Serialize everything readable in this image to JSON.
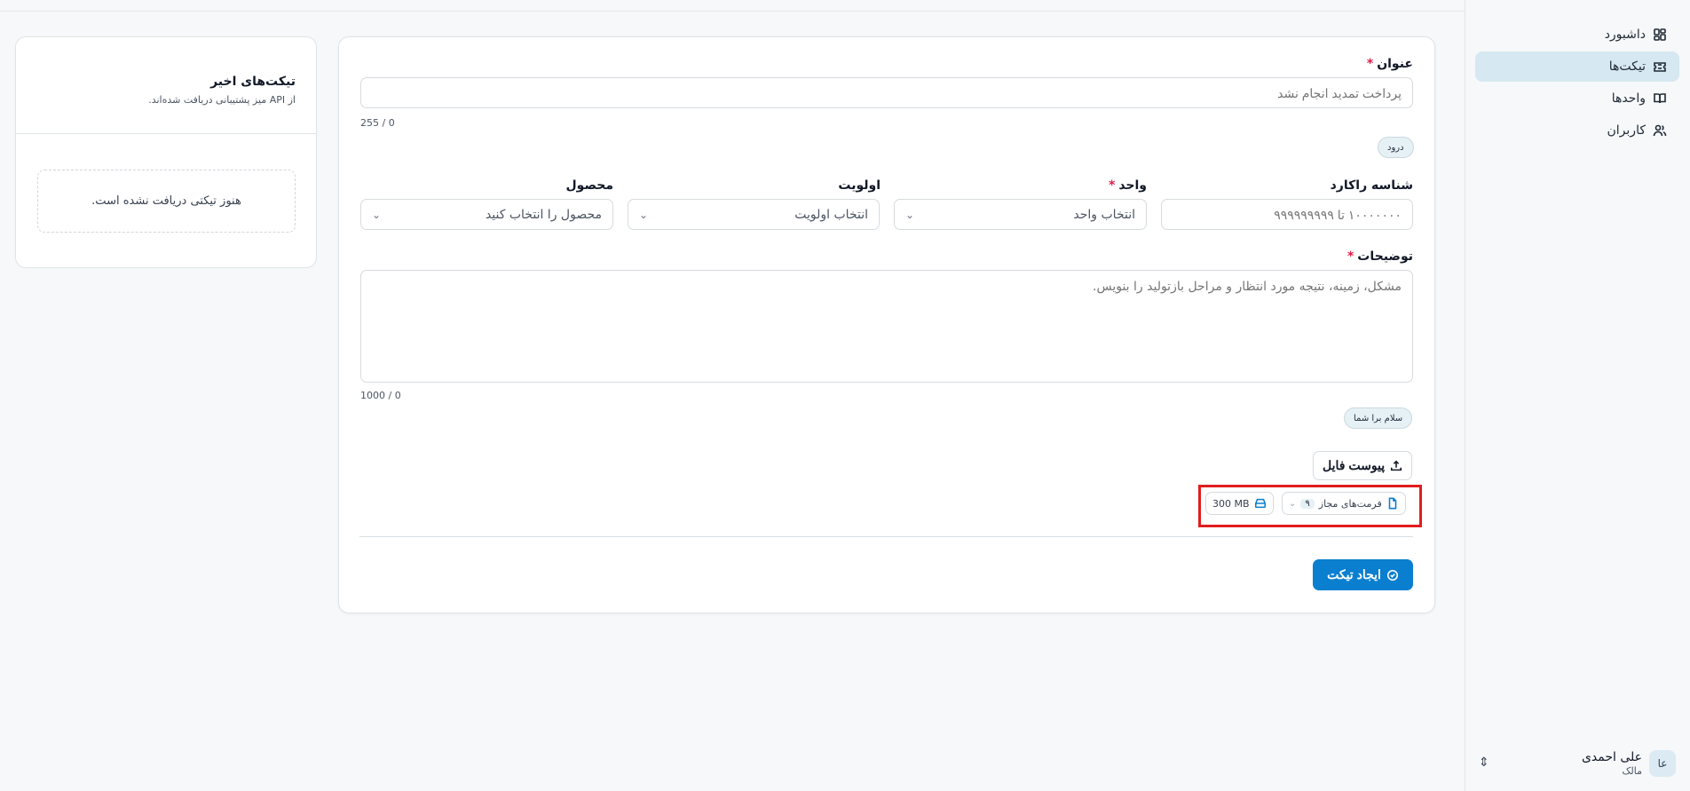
{
  "sidebar": {
    "items": [
      {
        "label": "داشبورد",
        "icon": "dashboard-icon",
        "active": false
      },
      {
        "label": "تیکت‌ها",
        "icon": "ticket-icon",
        "active": true
      },
      {
        "label": "واحدها",
        "icon": "book-icon",
        "active": false
      },
      {
        "label": "کاربران",
        "icon": "users-icon",
        "active": false
      }
    ],
    "user": {
      "initials": "عا",
      "name": "علی احمدی",
      "role": "مالک"
    }
  },
  "form": {
    "title": {
      "label": "عنوان",
      "placeholder": "پرداخت تمدید انجام نشد",
      "counter": "255 / 0",
      "chip": "درود"
    },
    "racard": {
      "label": "شناسه راکارد",
      "placeholder": "۱۰۰۰۰۰۰۰ تا ۹۹۹۹۹۹۹۹۹"
    },
    "unit": {
      "label": "واحد",
      "value": "انتخاب واحد"
    },
    "priority": {
      "label": "اولویت",
      "value": "انتخاب اولویت"
    },
    "product": {
      "label": "محصول",
      "value": "محصول را انتخاب کنید"
    },
    "description": {
      "label": "توضیحات",
      "placeholder": "مشکل، زمینه، نتیجه مورد انتظار و مراحل بازتولید را بنویس.",
      "counter": "1000 / 0",
      "chip": "سلام برا شما"
    },
    "attach_label": "پیوست فایل",
    "allowed_formats_label": "فرمت‌های مجاز",
    "allowed_formats_count": "۹",
    "max_size": "300 MB",
    "submit_label": "ایجاد تیکت"
  },
  "recent": {
    "title": "تیکت‌های اخیر",
    "subtitle": "از API میز پشتیبانی دریافت شده‌اند.",
    "empty": "هنوز تیکتی دریافت نشده است."
  },
  "colors": {
    "accent": "#0a7fd0",
    "active_nav": "#d6e8f1",
    "required": "#e11d48",
    "highlight": "#e11d1d"
  }
}
